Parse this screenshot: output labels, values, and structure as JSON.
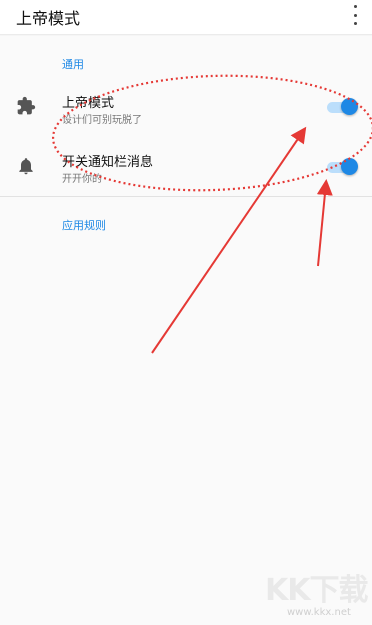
{
  "app": {
    "title": "上帝模式"
  },
  "sections": {
    "general": "通用",
    "rules": "应用规则"
  },
  "rows": [
    {
      "title": "上帝模式",
      "subtitle": "设计们可别玩脱了",
      "icon": "puzzle-icon",
      "enabled": true
    },
    {
      "title": "开关通知栏消息",
      "subtitle": "开开你的",
      "icon": "bell-icon",
      "enabled": true
    }
  ],
  "watermark": {
    "main": "KK下载",
    "sub": "www.kkx.net"
  },
  "colors": {
    "accent": "#1e88e5",
    "annotation": "#e53935"
  }
}
